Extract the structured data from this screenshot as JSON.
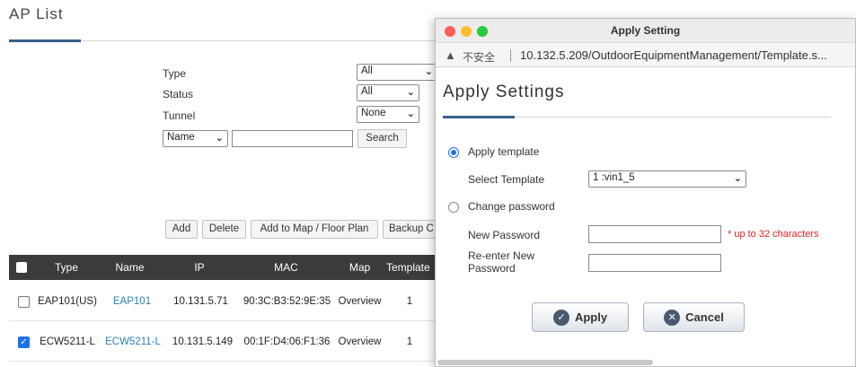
{
  "ap_list": {
    "title": "AP List",
    "filters": {
      "type_label": "Type",
      "type_value": "All",
      "status_label": "Status",
      "status_value": "All",
      "tunnel_label": "Tunnel",
      "tunnel_value": "None",
      "search_field_value": "Name",
      "search_button": "Search"
    },
    "actions": {
      "add": "Add",
      "delete": "Delete",
      "add_to_map": "Add to Map / Floor Plan",
      "backup": "Backup C"
    },
    "table": {
      "columns": [
        "Type",
        "Name",
        "IP",
        "MAC",
        "Map",
        "Template"
      ],
      "rows": [
        {
          "checked": false,
          "type": "EAP101(US)",
          "name": "EAP101",
          "ip": "10.131.5.71",
          "mac": "90:3C:B3:52:9E:35",
          "map": "Overview",
          "template": "1"
        },
        {
          "checked": true,
          "type": "ECW5211-L",
          "name": "ECW5211-L",
          "ip": "10.131.5.149",
          "mac": "00:1F:D4:06:F1:36",
          "map": "Overview",
          "template": "1"
        }
      ]
    }
  },
  "dialog": {
    "window_title": "Apply Setting",
    "url": {
      "warning_icon": "warning-triangle-icon",
      "warning_glyph": "▲",
      "insecure": "不安全",
      "address": "10.132.5.209/OutdoorEquipmentManagement/Template.s..."
    },
    "heading": "Apply Settings",
    "apply_template_label": "Apply template",
    "apply_template_selected": true,
    "select_template_label": "Select Template",
    "select_template_value": "1 :vin1_5",
    "change_password_label": "Change password",
    "change_password_selected": false,
    "new_password_label": "New Password",
    "new_password_hint": "* up to 32 characters",
    "reenter_password_label": "Re-enter New Password",
    "apply_button": "Apply",
    "cancel_button": "Cancel",
    "colors": {
      "close": "#fd5e57",
      "minimize": "#febc2e",
      "zoom": "#28c840",
      "accent": "#1a73e8"
    }
  }
}
